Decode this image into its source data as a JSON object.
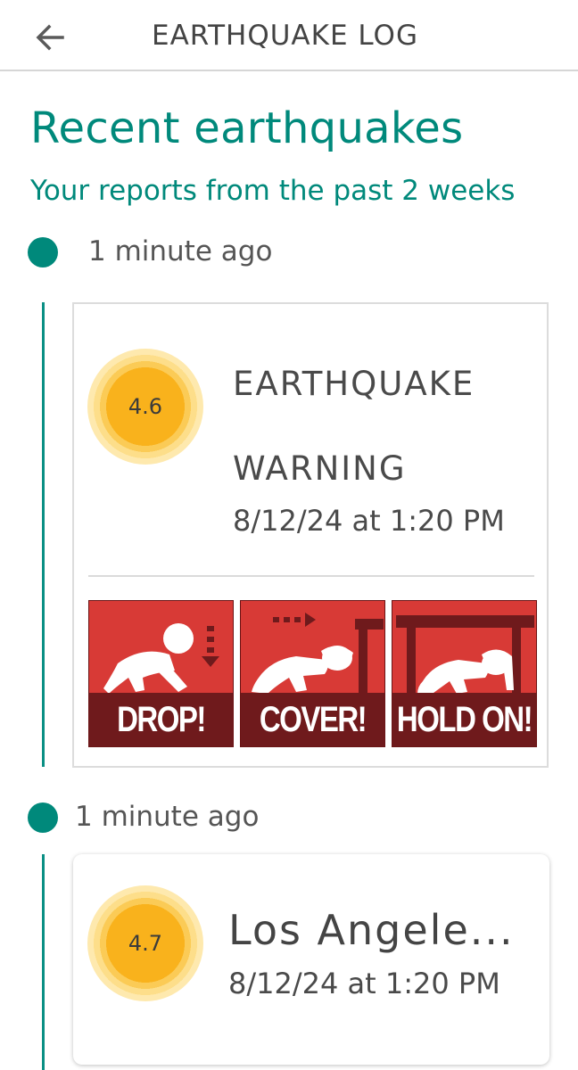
{
  "app_bar": {
    "title": "EARTHQUAKE LOG",
    "back_icon": "arrow-left-icon"
  },
  "header": {
    "title": "Recent earthquakes",
    "subtitle": "Your reports from the past 2 weeks"
  },
  "colors": {
    "accent": "#00897b",
    "magnitude": "#f9b21c",
    "panel_red": "#d83a36",
    "panel_dark": "#6f1a1c"
  },
  "entries": [
    {
      "time_ago": "1 minute ago",
      "magnitude": "4.6",
      "title_line1": "EARTHQUAKE",
      "title_line2": "WARNING",
      "datetime": "8/12/24 at 1:20 PM",
      "safety_steps": [
        {
          "label": "DROP!",
          "icon": "drop-figure-icon"
        },
        {
          "label": "COVER!",
          "icon": "cover-figure-icon"
        },
        {
          "label": "HOLD ON!",
          "icon": "hold-on-figure-icon"
        }
      ]
    },
    {
      "time_ago": "1 minute ago",
      "magnitude": "4.7",
      "location": "Los Angele...",
      "datetime": "8/12/24 at 1:20 PM"
    }
  ]
}
